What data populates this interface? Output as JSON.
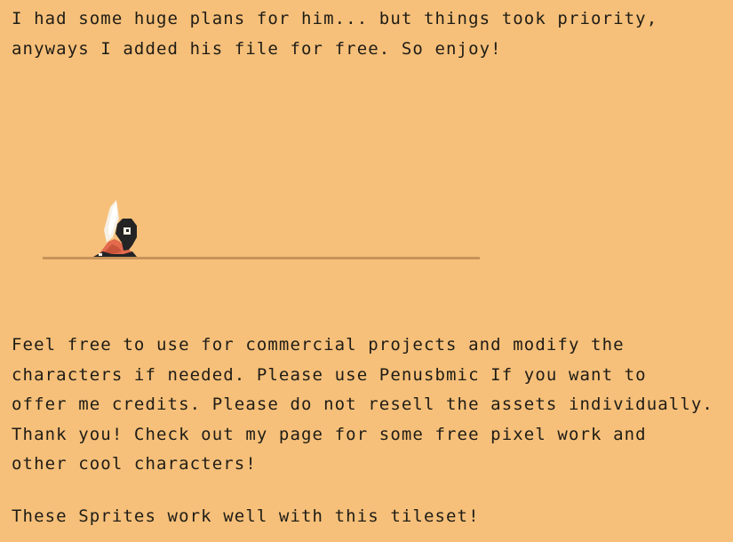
{
  "intro": {
    "line1": "I had some huge plans for him... but things took priority,",
    "line2": "anyways I added his file for free. So enjoy!"
  },
  "preview": {
    "sprite_icon": "hooded-character-sprite-icon",
    "ground_color": "#c7935a"
  },
  "license": {
    "line1": "Feel free to use for commercial projects and modify the",
    "line2": "characters if needed. Please use Penusbmic If you want to",
    "line3": "offer me credits. Please do not resell the assets individually.",
    "line4": "Thank you! Check out my page for some free pixel work and",
    "line5": "other cool characters!"
  },
  "tileset": {
    "text": "These Sprites work well with this tileset!"
  },
  "colors": {
    "background": "#f6c07a",
    "text": "#1f1c16",
    "sprite_dark": "#242424",
    "sprite_orange": "#e36a4d",
    "sprite_white": "#f7f0e5"
  }
}
